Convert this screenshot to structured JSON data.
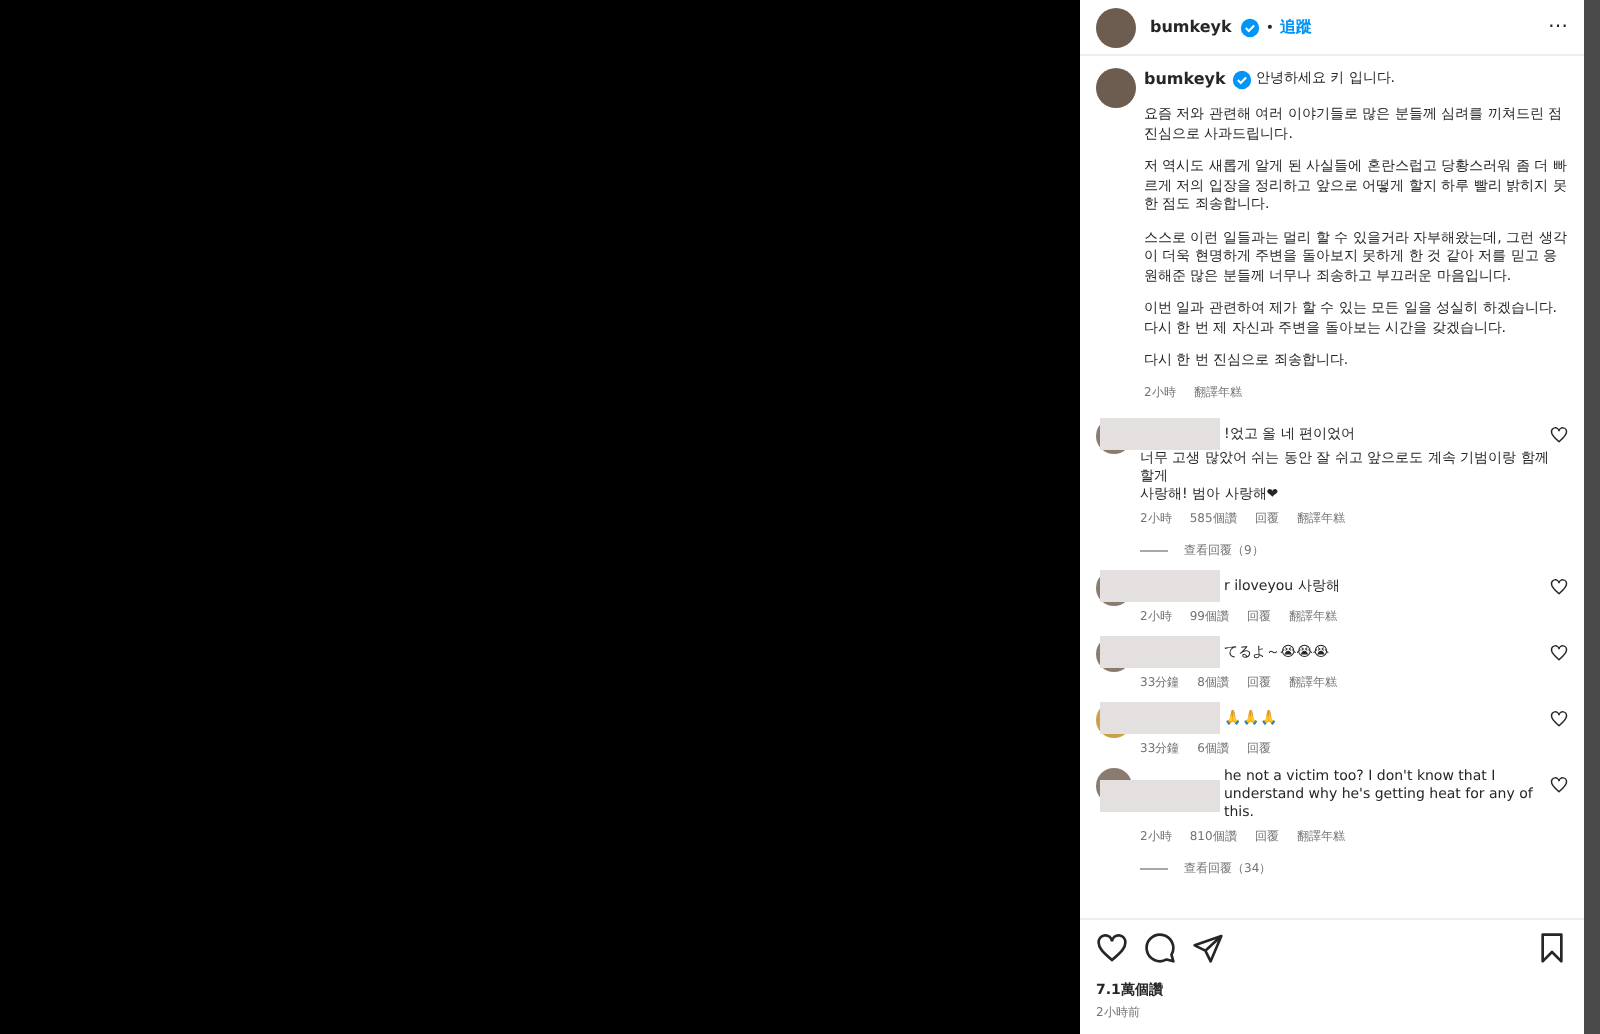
{
  "header": {
    "username": "bumkeyk",
    "verified": true,
    "separator": "•",
    "follow": "追蹤",
    "more": "⋯"
  },
  "caption": {
    "username": "bumkeyk",
    "verified": true,
    "paragraphs": [
      "안녕하세요 키 입니다.",
      "요즘 저와 관련해 여러 이야기들로 많은 분들께 심려를 끼쳐드린 점 진심으로 사과드립니다.",
      "저 역시도 새롭게 알게 된 사실들에 혼란스럽고 당황스러워 좀 더 빠르게 저의 입장을 정리하고 앞으로 어떻게 할지 하루 빨리 밝히지 못한 점도 죄송합니다.",
      "스스로 이런 일들과는 멀리 할 수 있을거라 자부해왔는데, 그런 생각이 더욱 현명하게 주변을 돌아보지 못하게 한 것 같아 저를 믿고 응원해준 많은 분들께 너무나 죄송하고 부끄러운 마음입니다.",
      "이번 일과 관련하여 제가 할 수 있는 모든 일을 성실히 하겠습니다. 다시 한 번 제 자신과 주변을 돌아보는 시간을 갖겠습니다.",
      "다시 한 번 진심으로 죄송합니다."
    ],
    "time": "2小時",
    "translate": "翻譯年糕"
  },
  "comments": [
    {
      "lines": [
        "!었고 올 네 편이었어",
        "너무 고생 많았어 쉬는 동안 잘 쉬고 앞으로도 계속 기범이랑 함께 할게",
        "사랑해! 범아 사랑해❤"
      ],
      "time": "2小時",
      "likes": "585個讚",
      "reply": "回覆",
      "translate": "翻譯年糕",
      "view_replies": "查看回覆（9）",
      "liked": false
    },
    {
      "lines": [
        "r iloveyou 사랑해"
      ],
      "time": "2小時",
      "likes": "99個讚",
      "reply": "回覆",
      "translate": "翻譯年糕",
      "liked": false
    },
    {
      "lines": [
        "てるよ～😭😭😭"
      ],
      "time": "33分鐘",
      "likes": "8個讚",
      "reply": "回覆",
      "translate": "翻譯年糕",
      "liked": false
    },
    {
      "lines": [
        "🙏🙏🙏"
      ],
      "time": "33分鐘",
      "likes": "6個讚",
      "reply": "回覆",
      "liked": false
    },
    {
      "lines": [
        "he not a victim too? I don't know that I understand why he's getting heat for any of this."
      ],
      "time": "2小時",
      "likes": "810個讚",
      "reply": "回覆",
      "translate": "翻譯年糕",
      "view_replies": "查看回覆（34）",
      "liked": false
    }
  ],
  "footer": {
    "liked": false,
    "saved": false,
    "likes": "7.1萬個讚",
    "time": "2小時前"
  }
}
